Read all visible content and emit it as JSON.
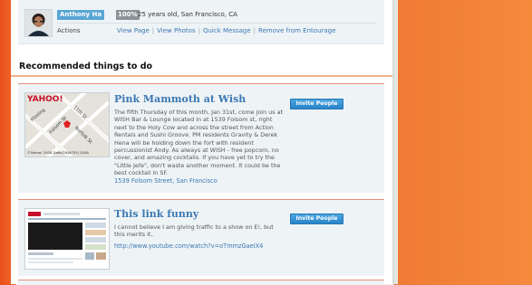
{
  "profile": {
    "name": "Anthony Ha",
    "percent": "100%",
    "details": "25 years old, San Francisco, CA",
    "actions_label": "Actions",
    "actions": [
      "View Page",
      "View Photos",
      "Quick Message",
      "Remove from Entourage"
    ]
  },
  "section": {
    "title": "Recommended things to do"
  },
  "recommendations": [
    {
      "title": "Pink Mammoth at Wish",
      "description": "The fifth Thursday of this month, Jan 31st, come join us at WISH Bar & Lounge located in at 1539 Folsom st, right next to the Holy Cow and across the street from Action Rentals and Sushi Groove. PM residents Gravity & Derek Hena will be holding down the fort with resident percussionist Andy. As always at WISH - free popcorn, no cover, and amazing cocktails. If you have yet to try the \"Little Jefe\", don't waste another moment. It could be the best cocktail in SF.",
      "link": "1539 Folsom Street, San Francisco",
      "button": "Invite People",
      "map": {
        "logo": "YAHOO!",
        "streets": [
          "Kissling",
          "11th St",
          "Folsom St",
          "Norfolk St"
        ],
        "copyright": "©Yahoo! 2008,Data©NAVTEQ 2008"
      }
    },
    {
      "title": "This link funny",
      "description": "I cannot believe I am giving traffic to a show on E!, but this merits it..",
      "link": "http://www.youtube.com/watch?v=oTmmzGaeIX4",
      "button": "Invite People"
    }
  ],
  "colors": {
    "accent": "#3b79b3",
    "orange": "#f06a2a",
    "button": "#2a84c8",
    "badge": "#58a6d4"
  }
}
